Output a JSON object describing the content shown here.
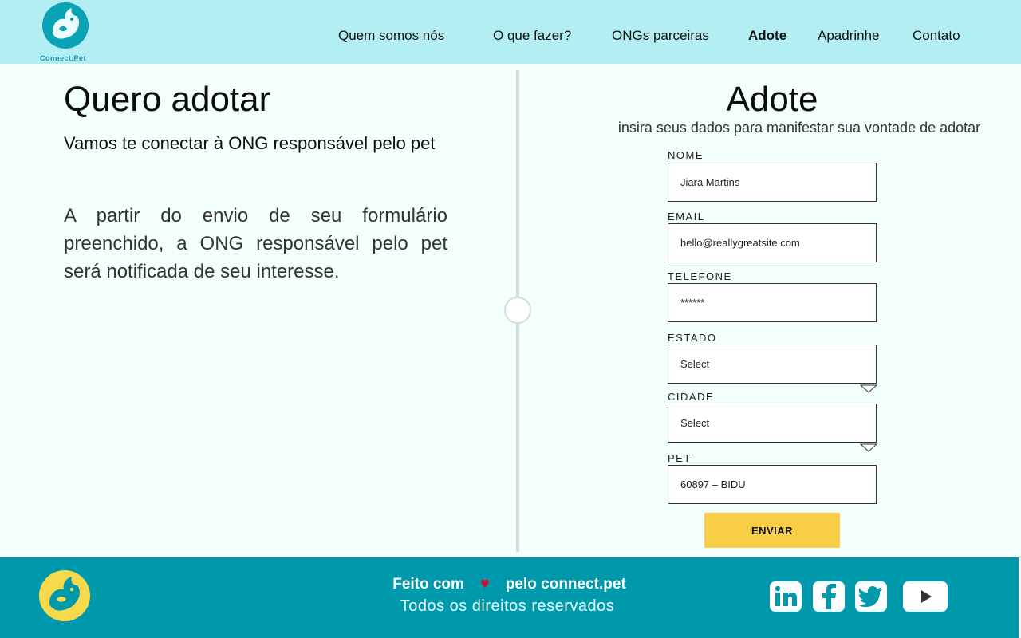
{
  "brand": {
    "name": "Connect.Pet"
  },
  "nav": {
    "items": [
      {
        "label": "Quem somos nós"
      },
      {
        "label": "O que fazer?"
      },
      {
        "label": "ONGs parceiras"
      },
      {
        "label": "Adote",
        "active": true
      },
      {
        "label": "Apadrinhe"
      },
      {
        "label": "Contato"
      }
    ]
  },
  "intro": {
    "title": "Quero adotar",
    "subtitle": "Vamos te conectar à ONG responsável pelo pet",
    "body": "A partir do envio de seu formulário preenchido, a ONG responsável pelo pet será notificada de seu interesse."
  },
  "form": {
    "title": "Adote",
    "subtitle": "insira seus dados para manifestar sua vontade de adotar",
    "fields": {
      "nome": {
        "label": "NOME",
        "value": "Jiara Martins"
      },
      "email": {
        "label": "EMAIL",
        "value": "hello@reallygreatsite.com"
      },
      "telefone": {
        "label": "TELEFONE",
        "value": "******"
      },
      "estado": {
        "label": "ESTADO",
        "value": "Select"
      },
      "cidade": {
        "label": "CIDADE",
        "value": "Select"
      },
      "pet": {
        "label": "PET",
        "value": "60897 – BIDU"
      }
    },
    "submit_label": "ENVIAR"
  },
  "footer": {
    "made_with_prefix": "Feito com",
    "made_with_suffix": "pelo connect.pet",
    "heart_icon": "♥",
    "rights": "Todos os direitos reservados",
    "social": [
      "linkedin-icon",
      "facebook-icon",
      "twitter-icon",
      "youtube-icon"
    ]
  },
  "colors": {
    "header_bg": "#b2eef2",
    "page_bg": "#f3fffd",
    "footer_bg": "#0098ab",
    "button_bg": "#f7ce46",
    "logo_teal": "#0aa3b5",
    "logo_yellow": "#f7d94c",
    "heart": "#c8102e"
  }
}
